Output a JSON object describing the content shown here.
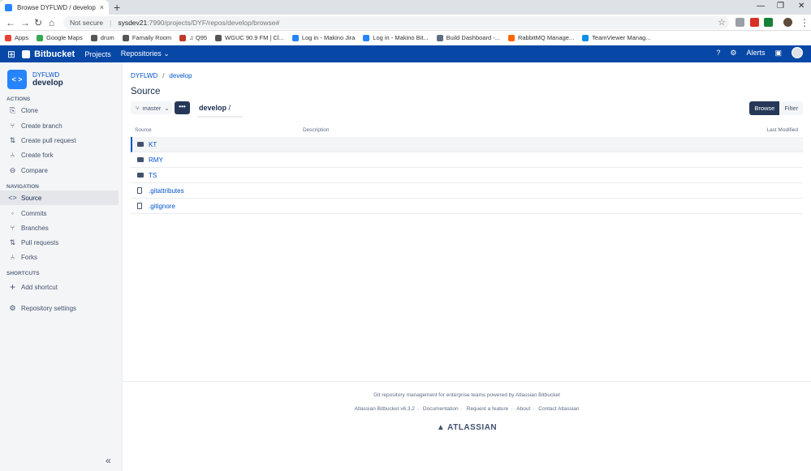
{
  "browser": {
    "tab_title": "Browse DYFLWD / develop - Ma",
    "tab_close": "×",
    "new_tab": "+",
    "window_controls": [
      "—",
      "❐",
      "✕"
    ],
    "security": "Not secure",
    "url_host": "sysdev21",
    "url_path": ":7990/projects/DYF/repos/develop/browse#",
    "bookmarks": [
      {
        "label": "Apps",
        "color": "#e94235"
      },
      {
        "label": "Google Maps",
        "color": "#34a853"
      },
      {
        "label": "drum",
        "color": "#555555"
      },
      {
        "label": "Famaily Room",
        "color": "#555555"
      },
      {
        "label": "♫ Q95",
        "color": "#c0392b"
      },
      {
        "label": "WGUC 90.9 FM | Cl...",
        "color": "#555555"
      },
      {
        "label": "Log in - Makino Jira",
        "color": "#2684FF"
      },
      {
        "label": "Log in - Makino Bit...",
        "color": "#2684FF"
      },
      {
        "label": "Build Dashboard -...",
        "color": "#5E6C84"
      },
      {
        "label": "RabbitMQ Manage...",
        "color": "#ff6600"
      },
      {
        "label": "TeamViewer Manag...",
        "color": "#0e8ee9"
      }
    ]
  },
  "header": {
    "logo": "Bitbucket",
    "nav": [
      "Projects",
      "Repositories ⌄"
    ],
    "alerts": "Alerts",
    "help_icon": "?",
    "settings_icon": "⚙"
  },
  "sidebar": {
    "project": "DYFLWD",
    "repo": "develop",
    "repo_icon": "< >",
    "sections": {
      "actions": "ACTIONS",
      "navigation": "NAVIGATION",
      "shortcuts": "SHORTCUTS"
    },
    "actions": [
      {
        "label": "Clone",
        "icon": "⎘"
      },
      {
        "label": "Create branch",
        "icon": "⑂"
      },
      {
        "label": "Create pull request",
        "icon": "⇅"
      },
      {
        "label": "Create fork",
        "icon": "⑃"
      },
      {
        "label": "Compare",
        "icon": "⊖"
      }
    ],
    "navigation": [
      {
        "label": "Source",
        "icon": "<>"
      },
      {
        "label": "Commits",
        "icon": "◦"
      },
      {
        "label": "Branches",
        "icon": "⑂"
      },
      {
        "label": "Pull requests",
        "icon": "⇅"
      },
      {
        "label": "Forks",
        "icon": "⑃"
      }
    ],
    "add_shortcut": "Add shortcut",
    "repo_settings": "Repository settings",
    "collapse": "«"
  },
  "main": {
    "breadcrumb": [
      "DYFLWD",
      "develop"
    ],
    "title": "Source",
    "branch": "master",
    "more": "•••",
    "path": "develop",
    "path_sep": "/",
    "view_browse": "Browse",
    "view_filter": "Filter",
    "columns": [
      "Source",
      "Description",
      "Last Modified"
    ],
    "files": [
      {
        "name": "KT",
        "type": "folder"
      },
      {
        "name": "RMY",
        "type": "folder"
      },
      {
        "name": "TS",
        "type": "folder"
      },
      {
        "name": ".gitattributes",
        "type": "file"
      },
      {
        "name": ".gitignore",
        "type": "file"
      }
    ]
  },
  "footer": {
    "tagline": "Git repository management for enterprise teams powered by Atlassian Bitbucket",
    "links": [
      "Atlassian Bitbucket v6.3.2",
      "Documentation",
      "Request a feature",
      "About",
      "Contact Atlassian"
    ],
    "brand": "ATLASSIAN"
  }
}
